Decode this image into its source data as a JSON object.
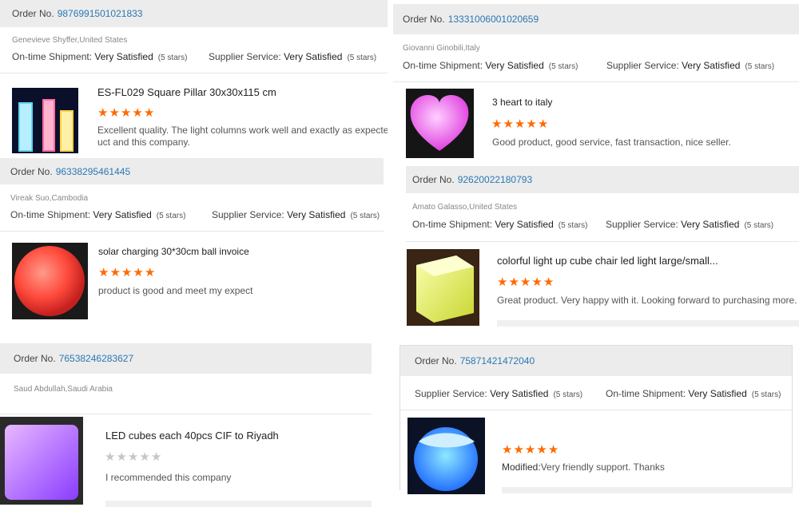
{
  "labels": {
    "order_no": "Order No.",
    "shipment": "On-time Shipment:",
    "supplier": "Supplier Service:"
  },
  "colors": {
    "star_orange": "#ff6a00",
    "star_grey": "#c6c6c6",
    "link": "#2a78b4"
  },
  "reviews": [
    {
      "order_number": "9876991501021833",
      "buyer": "Genevieve Shyffer,United States",
      "shipment_rating": "Very Satisfied",
      "shipment_stars": "(5 stars)",
      "supplier_rating": "Very Satisfied",
      "supplier_stars": "(5 stars)",
      "product_title": "ES-FL029 Square Pillar 30x30x115 cm",
      "stars_filled": 5,
      "comment_line1": "Excellent quality. The light columns work well and exactly as expected.",
      "comment_line2": "uct and this company."
    },
    {
      "order_number": "96338295461445",
      "buyer": "Vireak Suo,Cambodia",
      "shipment_rating": "Very Satisfied",
      "shipment_stars": "(5 stars)",
      "supplier_rating": "Very Satisfied",
      "supplier_stars": "(5 stars)",
      "product_title": "solar charging 30*30cm ball invoice",
      "stars_filled": 5,
      "comment_line1": "product is good and meet my expect"
    },
    {
      "order_number": "76538246283627",
      "buyer": "Saud Abdullah,Saudi Arabia",
      "product_title": "LED cubes each 40pcs CIF to Riyadh",
      "stars_filled": 0,
      "comment_line1": "I recommended this company"
    },
    {
      "order_number": "13331006001020659",
      "buyer": "Giovanni Ginobili,Italy",
      "shipment_rating": "Very Satisfied",
      "shipment_stars": "(5 stars)",
      "supplier_rating": "Very Satisfied",
      "supplier_stars": "(5 stars)",
      "product_title": "3 heart to italy",
      "stars_filled": 5,
      "comment_line1": "Good product, good service, fast transaction, nice seller."
    },
    {
      "order_number": "92620022180793",
      "buyer": "Amato Galasso,United States",
      "shipment_rating": "Very Satisfied",
      "shipment_stars": "(5 stars)",
      "supplier_rating": "Very Satisfied",
      "supplier_stars": "(5 stars)",
      "product_title": "colorful light up cube chair led light large/small...",
      "stars_filled": 5,
      "comment_line1": "Great product.  Very happy with it.  Looking forward to purchasing more."
    },
    {
      "order_number": "75871421472040",
      "shipment_rating": "Very Satisfied",
      "shipment_stars": "(5 stars)",
      "supplier_rating": "Very Satisfied",
      "supplier_stars": "(5 stars)",
      "stars_filled": 5,
      "comment_prefix": "Modified:",
      "comment_line1": "Very friendly support. Thanks"
    }
  ]
}
